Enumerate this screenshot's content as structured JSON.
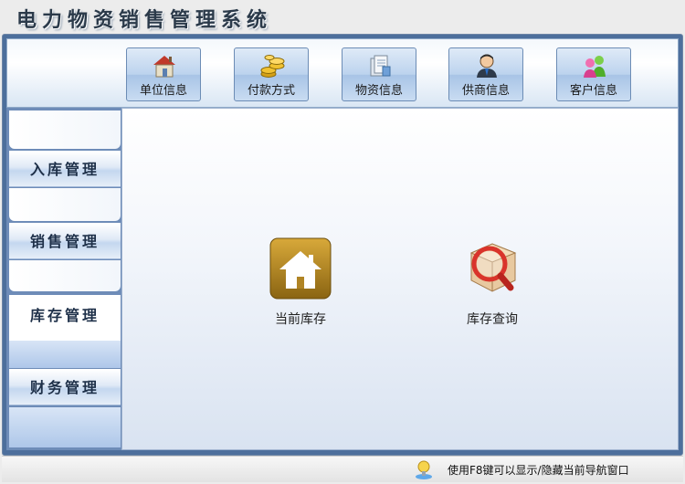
{
  "app": {
    "title": "电力物资销售管理系统"
  },
  "toolbar": {
    "buttons": [
      {
        "label": "单位信息",
        "icon": "house-icon"
      },
      {
        "label": "付款方式",
        "icon": "coins-icon"
      },
      {
        "label": "物资信息",
        "icon": "documents-icon"
      },
      {
        "label": "供商信息",
        "icon": "person-icon"
      },
      {
        "label": "客户信息",
        "icon": "customers-icon"
      }
    ]
  },
  "nav": {
    "items": [
      {
        "label": "入库管理",
        "active": false
      },
      {
        "label": "销售管理",
        "active": false
      },
      {
        "label": "库存管理",
        "active": true
      },
      {
        "label": "财务管理",
        "active": false
      }
    ]
  },
  "content": {
    "items": [
      {
        "label": "当前库存",
        "icon": "home-icon"
      },
      {
        "label": "库存查询",
        "icon": "magnifier-box-icon"
      }
    ]
  },
  "status": {
    "text": "使用F8键可以显示/隐藏当前导航窗口"
  }
}
